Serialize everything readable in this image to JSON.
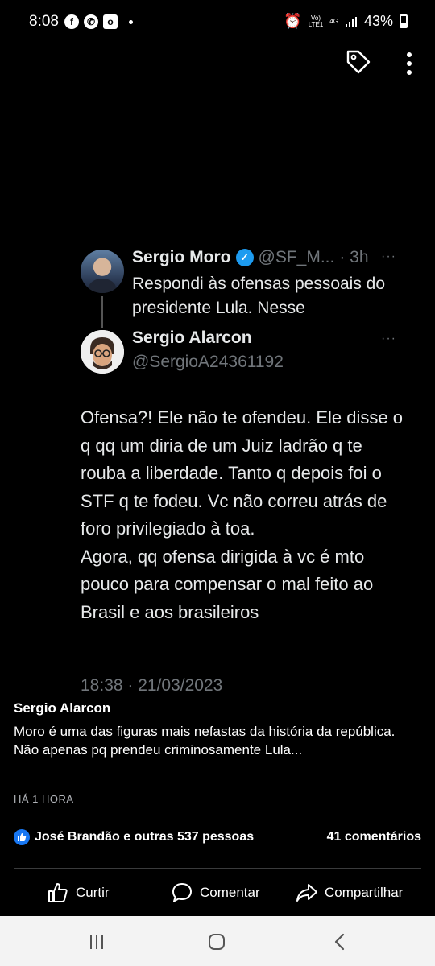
{
  "status_bar": {
    "time": "8:08",
    "left_icons": [
      "facebook-icon",
      "whatsapp-icon",
      "outlook-icon"
    ],
    "network_top": "Vo)",
    "network_bottom": "LTE1",
    "data_type": "4G",
    "battery": "43%"
  },
  "tweet": {
    "parent": {
      "name": "Sergio Moro",
      "handle": "@SF_M...",
      "time": "· 3h",
      "text": "Respondi às ofensas pessoais do presidente Lula. Nesse"
    },
    "reply": {
      "name": "Sergio Alarcon",
      "handle": "@SergioA24361192",
      "body": "Ofensa?! Ele não te ofendeu. Ele disse o q qq um diria de um Juiz ladrão q te rouba a liberdade. Tanto q depois foi o STF q te fodeu. Vc não correu atrás de foro privilegiado à toa.\nAgora, qq ofensa dirigida à vc é mto pouco para compensar o mal feito ao Brasil e aos brasileiros",
      "date": "18:38 · 21/03/2023"
    },
    "more_glyph": "···"
  },
  "post": {
    "author": "Sergio Alarcon",
    "text": "Moro é uma das figuras mais nefastas da história da república. Não  apenas pq prendeu criminosamente Lula...",
    "time": "HÁ 1 HORA",
    "reactions": "José Brandão e outras 537 pessoas",
    "comments": "41 comentários"
  },
  "actions": {
    "like": "Curtir",
    "comment": "Comentar",
    "share": "Compartilhar"
  },
  "colors": {
    "background": "#000000",
    "verified": "#1d9bf0",
    "like_blue": "#1877f2",
    "muted": "#71767b"
  }
}
